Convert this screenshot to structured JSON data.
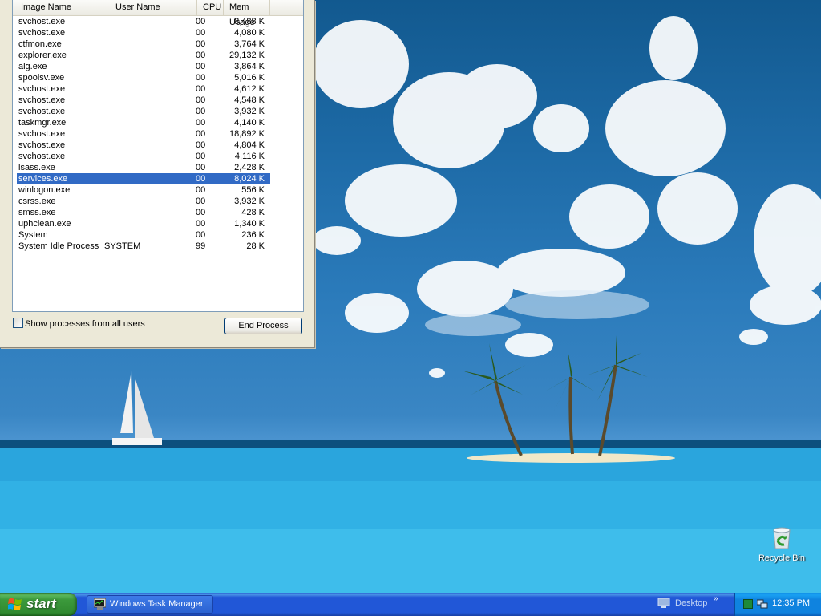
{
  "task_manager": {
    "columns": {
      "name": "Image Name",
      "user": "User Name",
      "cpu": "CPU",
      "mem": "Mem Usage"
    },
    "processes": [
      {
        "name": "svchost.exe",
        "user": "",
        "cpu": "00",
        "mem": "8,488 K"
      },
      {
        "name": "svchost.exe",
        "user": "",
        "cpu": "00",
        "mem": "4,080 K"
      },
      {
        "name": "ctfmon.exe",
        "user": "",
        "cpu": "00",
        "mem": "3,764 K"
      },
      {
        "name": "explorer.exe",
        "user": "",
        "cpu": "00",
        "mem": "29,132 K"
      },
      {
        "name": "alg.exe",
        "user": "",
        "cpu": "00",
        "mem": "3,864 K"
      },
      {
        "name": "spoolsv.exe",
        "user": "",
        "cpu": "00",
        "mem": "5,016 K"
      },
      {
        "name": "svchost.exe",
        "user": "",
        "cpu": "00",
        "mem": "4,612 K"
      },
      {
        "name": "svchost.exe",
        "user": "",
        "cpu": "00",
        "mem": "4,548 K"
      },
      {
        "name": "svchost.exe",
        "user": "",
        "cpu": "00",
        "mem": "3,932 K"
      },
      {
        "name": "taskmgr.exe",
        "user": "",
        "cpu": "00",
        "mem": "4,140 K"
      },
      {
        "name": "svchost.exe",
        "user": "",
        "cpu": "00",
        "mem": "18,892 K"
      },
      {
        "name": "svchost.exe",
        "user": "",
        "cpu": "00",
        "mem": "4,804 K"
      },
      {
        "name": "svchost.exe",
        "user": "",
        "cpu": "00",
        "mem": "4,116 K"
      },
      {
        "name": "lsass.exe",
        "user": "",
        "cpu": "00",
        "mem": "2,428 K"
      },
      {
        "name": "services.exe",
        "user": "",
        "cpu": "00",
        "mem": "8,024 K",
        "selected": true
      },
      {
        "name": "winlogon.exe",
        "user": "",
        "cpu": "00",
        "mem": "556 K"
      },
      {
        "name": "csrss.exe",
        "user": "",
        "cpu": "00",
        "mem": "3,932 K"
      },
      {
        "name": "smss.exe",
        "user": "",
        "cpu": "00",
        "mem": "428 K"
      },
      {
        "name": "uphclean.exe",
        "user": "",
        "cpu": "00",
        "mem": "1,340 K"
      },
      {
        "name": "System",
        "user": "",
        "cpu": "00",
        "mem": "236 K"
      },
      {
        "name": "System Idle Process",
        "user": "SYSTEM",
        "cpu": "99",
        "mem": "28 K"
      }
    ],
    "show_all_label": "Show processes from all users",
    "show_all_checked": false,
    "end_process_label": "End Process"
  },
  "desktop": {
    "recycle_bin_label": "Recycle Bin"
  },
  "taskbar": {
    "start_label": "start",
    "task_button_label": "Windows Task Manager",
    "desktop_toolbar_label": "Desktop",
    "clock": "12:35 PM"
  },
  "colors": {
    "selection": "#316ac5",
    "taskbar": "#2157d7",
    "start_button": "#3c9a3c",
    "tray": "#0f83df"
  }
}
